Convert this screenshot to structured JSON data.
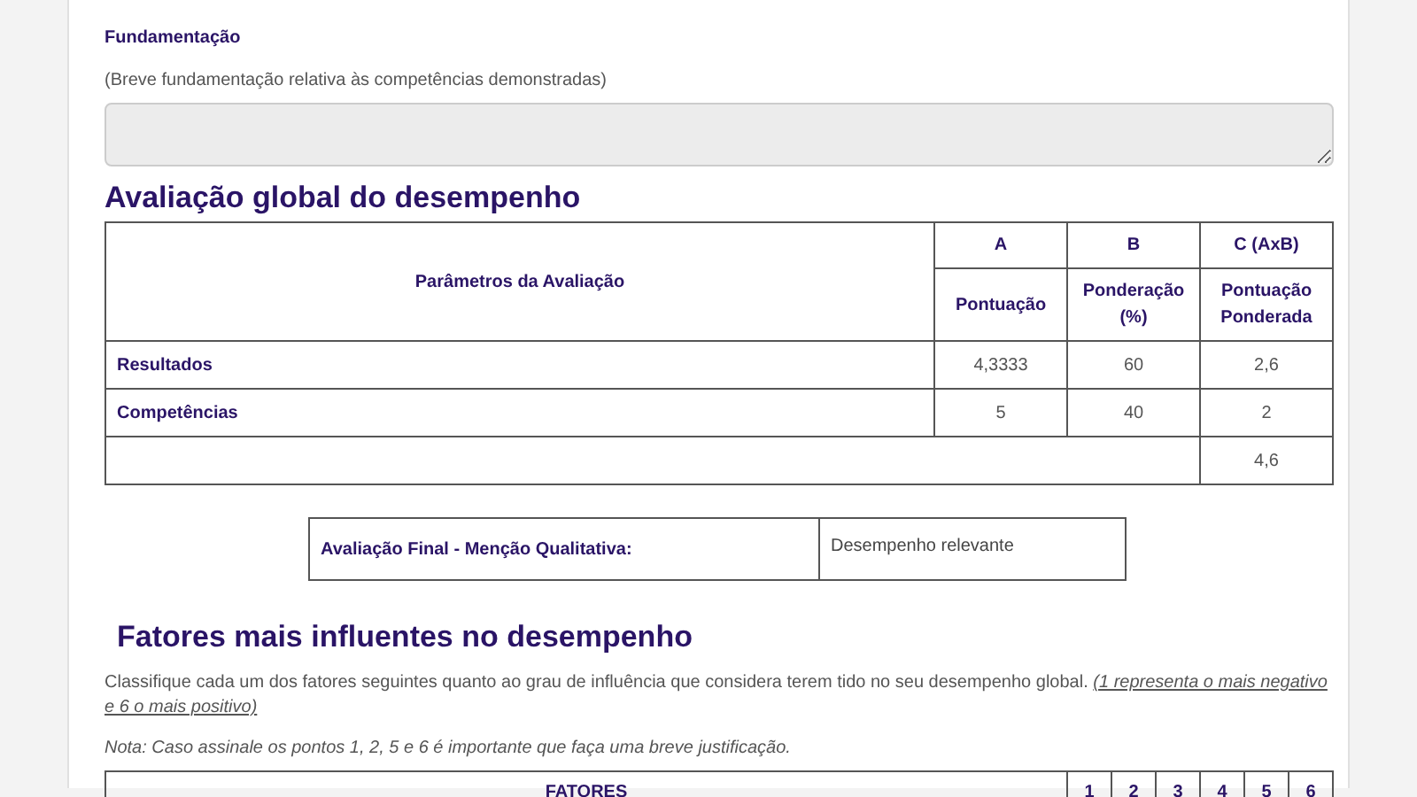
{
  "justification": {
    "label": "Fundamentação",
    "hint": "(Breve fundamentação relativa às competências demonstradas)"
  },
  "global": {
    "title": "Avaliação global do desempenho",
    "param_header": "Parâmetros da Avaliação",
    "columns": [
      {
        "letter": "A",
        "name": "Pontuação"
      },
      {
        "letter": "B",
        "name": "Ponderação (%)"
      },
      {
        "letter": "C (AxB)",
        "name": "Pontuação Ponderada"
      }
    ],
    "rows": [
      {
        "label": "Resultados",
        "values": [
          "4,3333",
          "60",
          "2,6"
        ]
      },
      {
        "label": "Competências",
        "values": [
          "5",
          "40",
          "2"
        ]
      }
    ],
    "total": "4,6"
  },
  "final": {
    "label": "Avaliação Final - Menção Qualitativa:",
    "value": "Desempenho relevante"
  },
  "factors": {
    "title": "Fatores mais influentes no desempenho",
    "instruction": "Classifique cada um dos fatores seguintes quanto ao grau de influência que considera terem tido no seu desempenho global.",
    "scale_hint": "(1 representa o mais negativo e 6 o mais positivo)",
    "note": "Nota: Caso assinale os pontos 1, 2, 5 e 6 é importante que faça uma breve justificação.",
    "header": "FATORES",
    "scale": [
      "1",
      "2",
      "3",
      "4",
      "5",
      "6"
    ]
  }
}
